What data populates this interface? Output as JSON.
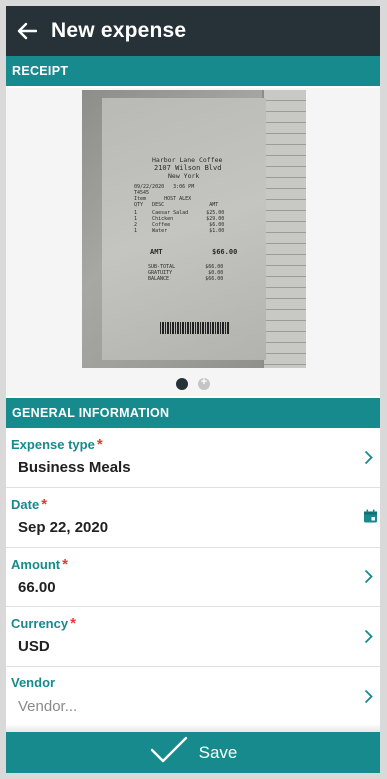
{
  "app_bar": {
    "title": "New expense",
    "back_icon": "arrow-left-icon"
  },
  "receipt_section": {
    "header": "RECEIPT",
    "receipt": {
      "merchant": "Harbor Lane Coffee",
      "address": "2107 Wilson Blvd",
      "city": "New York",
      "date_line": "09/22/2020   3:06 PM",
      "line2": "T4545",
      "line3": "Item      HOST ALEX",
      "header_row": "QTY   DESC               AMT",
      "items": [
        "1     Caesar Salad      $25.00",
        "1     Chicken           $29.00",
        "2     Coffee             $6.00",
        "1     Water              $1.00"
      ],
      "amt_label": "AMT",
      "amt_value": "$66.00",
      "totals": [
        "SUB-TOTAL          $66.00",
        "GRATUITY            $0.00",
        "BALANCE            $66.00"
      ]
    },
    "pager": {
      "pages": 2,
      "current": 1
    }
  },
  "general_section": {
    "header": "GENERAL INFORMATION"
  },
  "fields": {
    "expense_type": {
      "label": "Expense type",
      "required_mark": "*",
      "value": "Business Meals"
    },
    "date": {
      "label": "Date",
      "required_mark": "*",
      "value": "Sep 22, 2020"
    },
    "amount": {
      "label": "Amount",
      "required_mark": "*",
      "value": "66.00"
    },
    "currency": {
      "label": "Currency",
      "required_mark": "*",
      "value": "USD"
    },
    "vendor": {
      "label": "Vendor",
      "placeholder": "Vendor..."
    }
  },
  "save_bar": {
    "label": "Save",
    "icon": "checkmark-icon"
  },
  "colors": {
    "app_bar": "#263238",
    "accent": "#178a8e",
    "required": "#e53935"
  }
}
